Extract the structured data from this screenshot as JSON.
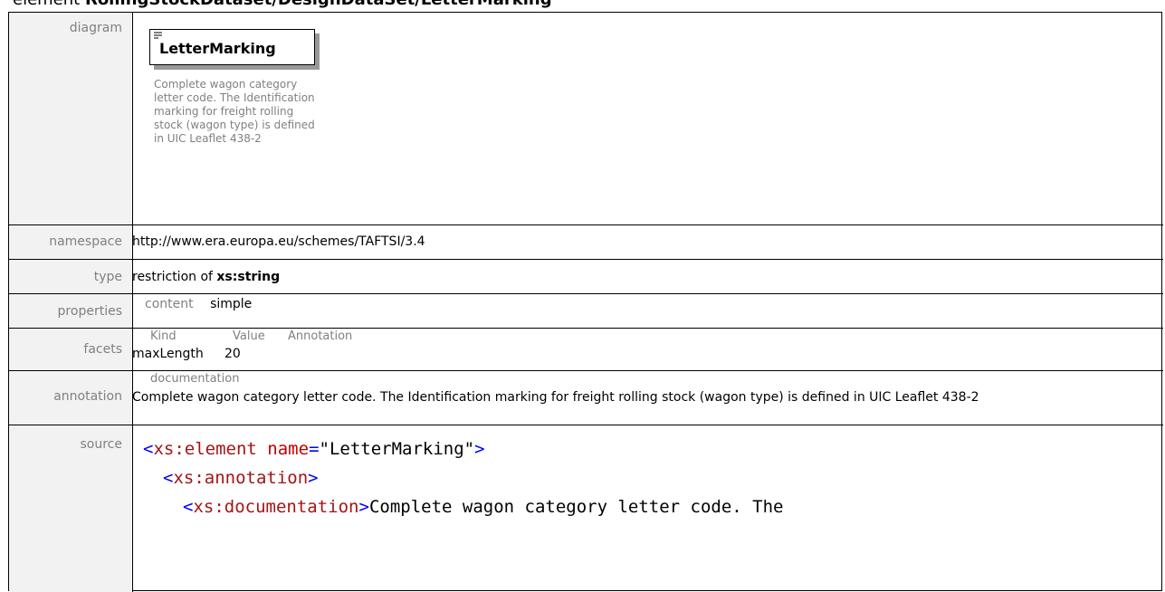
{
  "heading": {
    "prefix": "element ",
    "path": "RollingStockDataset/DesignDataSet/LetterMarking"
  },
  "diagram": {
    "label": "diagram",
    "title": "LetterMarking",
    "description": "Complete wagon category letter code. The Identification marking for freight rolling stock (wagon type) is defined in UIC Leaflet 438-2"
  },
  "namespace": {
    "label": "namespace",
    "value": "http://www.era.europa.eu/schemes/TAFTSI/3.4"
  },
  "type": {
    "label": "type",
    "prefix": "restriction of ",
    "base": "xs:string"
  },
  "properties": {
    "label": "properties",
    "key": "content",
    "value": "simple"
  },
  "facets": {
    "label": "facets",
    "headers": [
      "Kind",
      "Value",
      "Annotation"
    ],
    "rows": [
      {
        "kind": "maxLength",
        "value": "20",
        "annotation": ""
      }
    ]
  },
  "annotation": {
    "label": "annotation",
    "sublabel": "documentation",
    "text": "Complete wagon category letter code. The Identification marking for freight rolling stock (wagon type) is defined in UIC Leaflet 438-2"
  },
  "source": {
    "label": "source",
    "line1": {
      "open": "<",
      "tag": "xs:element",
      "attr": "name",
      "eq": "=",
      "value": "\"LetterMarking\"",
      "close": ">"
    },
    "line2": {
      "open": "<",
      "tag": "xs:annotation",
      "close": ">"
    },
    "line3": {
      "open": "<",
      "tag": "xs:documentation",
      "close": ">",
      "text": "Complete wagon category letter code. The"
    }
  }
}
